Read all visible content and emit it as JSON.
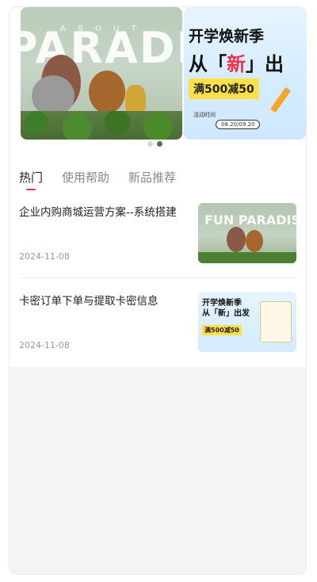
{
  "carousel": {
    "slides": [
      {
        "banner_word": "PARADISE",
        "small_word": "A B O U T"
      },
      {
        "headline": "开学焕新季",
        "subline_prefix": "从「",
        "subline_highlight": "新",
        "subline_suffix": "」出",
        "badge": "满500减50",
        "date_label": "活动时间",
        "date_range": "08.20/09.20"
      }
    ],
    "active_index": 1
  },
  "tabs": [
    {
      "label": "热门"
    },
    {
      "label": "使用帮助"
    },
    {
      "label": "新品推荐"
    }
  ],
  "active_tab": 0,
  "articles": [
    {
      "title": "企业内购商城运营方案--系统搭建",
      "date": "2024-11-08",
      "thumb_text": "FUN PARADISE"
    },
    {
      "title": "卡密订单下单与提取卡密信息",
      "date": "2024-11-08",
      "thumb_text": "开学焕新季 从「新」出发",
      "thumb_badge": "满500减50"
    }
  ],
  "colors": {
    "accent": "#e8334a",
    "promo_yellow": "#ffe04a",
    "page_bg": "#f4f4f4"
  }
}
